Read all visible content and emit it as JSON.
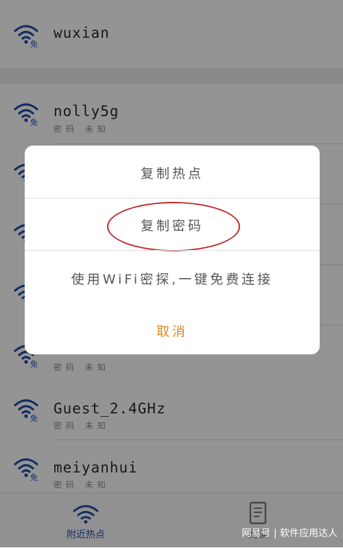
{
  "colors": {
    "accent": "#1f4fa8",
    "cancel": "#e08a1c",
    "highlight_circle": "#c62828"
  },
  "wifi_list": [
    {
      "ssid": "wuxian",
      "status": ""
    },
    {
      "ssid": "nolly5g",
      "status": "密码 未知"
    },
    {
      "ssid": "",
      "status": ""
    },
    {
      "ssid": "",
      "status": ""
    },
    {
      "ssid": "",
      "status": ""
    },
    {
      "ssid": "",
      "status": "密码 未知"
    },
    {
      "ssid": "Guest_2.4GHz",
      "status": "密码 未知"
    },
    {
      "ssid": "meiyanhui",
      "status": "密码 未知"
    }
  ],
  "wifi_badge": "免",
  "dialog": {
    "copy_hotspot": "复制热点",
    "copy_password": "复制密码",
    "use_wifi_explore": "使用WiFi密探,一键免费连接",
    "cancel": "取消"
  },
  "tabbar": {
    "nearby": "附近热点",
    "read": "阅读"
  },
  "watermark": "网易号 | 软件应用达人"
}
